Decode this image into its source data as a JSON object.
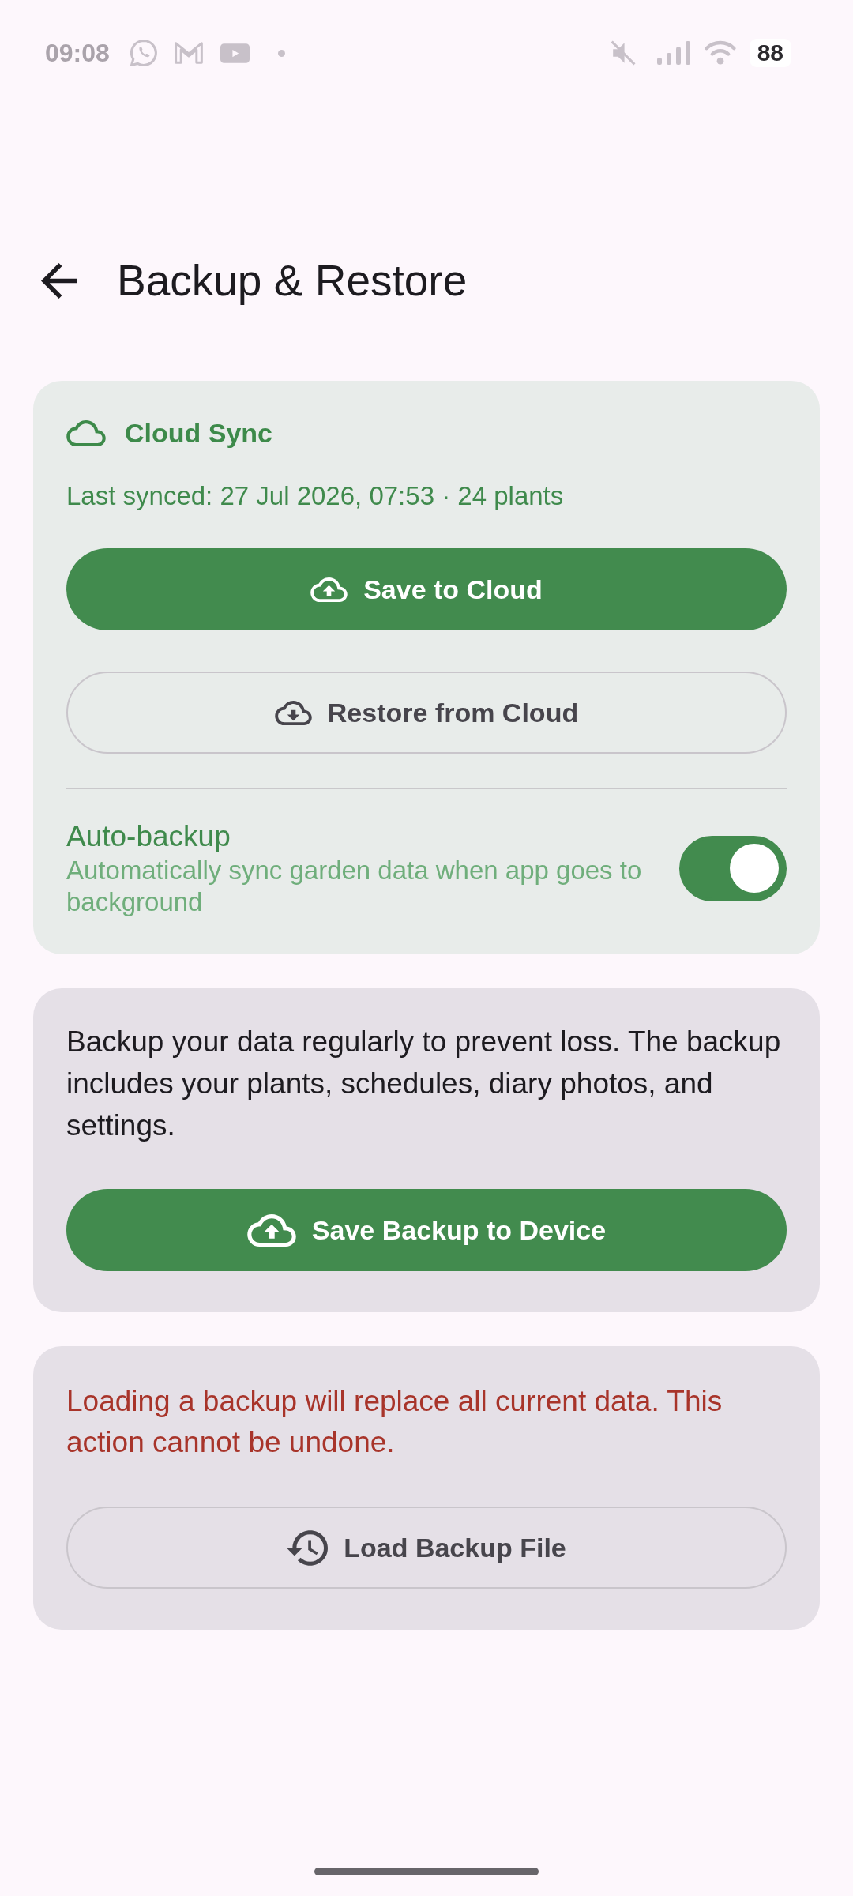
{
  "status_bar": {
    "time": "09:08",
    "battery": "88"
  },
  "app_bar": {
    "title": "Backup & Restore"
  },
  "cloud_sync": {
    "title": "Cloud Sync",
    "last_synced": "Last synced: 27 Jul 2026, 07:53 · 24 plants",
    "buttons": [
      {
        "label": "Save to Cloud",
        "kind": "filled"
      },
      {
        "label": "Restore from Cloud",
        "kind": "outlined"
      }
    ],
    "auto_backup": {
      "label": "Auto-backup",
      "description": "Automatically sync garden data when app goes to background",
      "on": true
    }
  },
  "device_backup": {
    "text": "Backup your data regularly to prevent loss. The backup includes your plants, schedules, diary photos, and settings.",
    "buttons": [
      {
        "label": "Save Backup to Device",
        "kind": "filled"
      }
    ]
  },
  "restore_file": {
    "warning": "Loading a backup will replace all current data. This action cannot be undone.",
    "buttons": [
      {
        "label": "Load Backup File",
        "kind": "outlined"
      }
    ]
  }
}
